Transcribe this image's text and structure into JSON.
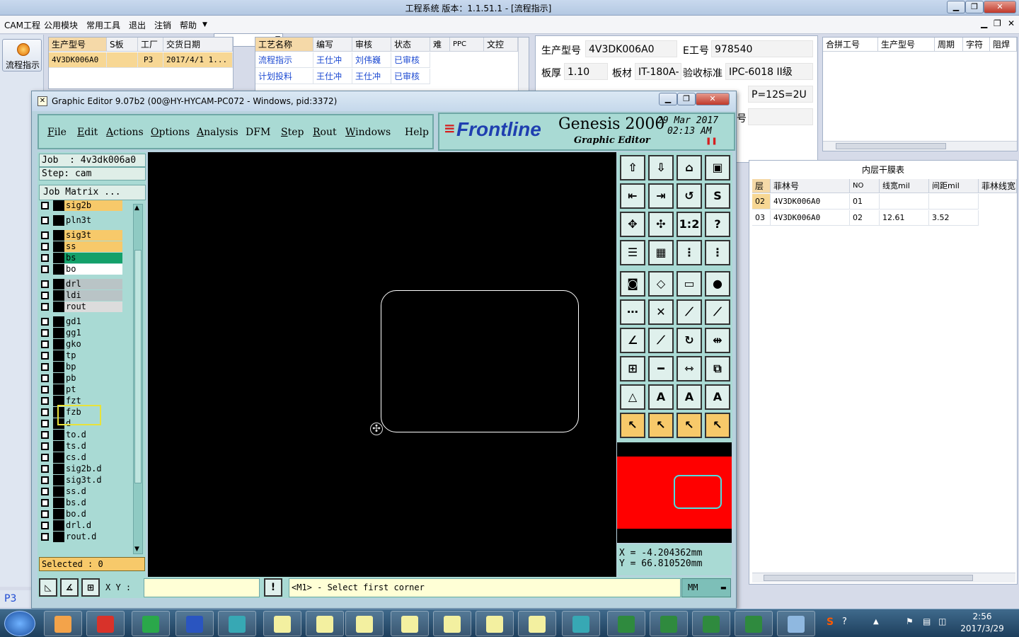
{
  "app": {
    "title": "工程系统    版本：1.1.51.1 - [流程指示]",
    "menu": [
      "CAM工程",
      "公用模块",
      "常用工具",
      "退出",
      "注销",
      "帮助"
    ],
    "flow_button": "流程指示",
    "left_status": "P3"
  },
  "job_grid": {
    "headers": [
      "生产型号",
      "S板",
      "工厂",
      "交货日期"
    ],
    "row": [
      "4V3DK006A0",
      "",
      "P3",
      "2017/4/1 1..."
    ]
  },
  "process_grid": {
    "headers": [
      "工艺名称",
      "编写",
      "审核",
      "状态",
      "难",
      "PPC",
      "文控"
    ],
    "rows": [
      [
        "流程指示",
        "王仕冲",
        "刘伟巍",
        "已审核",
        "",
        "",
        ""
      ],
      [
        "计划投料",
        "王仕冲",
        "王仕冲",
        "已审核",
        "",
        "",
        ""
      ]
    ]
  },
  "info": {
    "model_label": "生产型号",
    "model_value": "4V3DK006A0",
    "eno_label": "E工号",
    "eno_value": "978540",
    "thick_label": "板厚",
    "thick_value": "1.10",
    "material_label": "板材",
    "material_value": "IT-180A-",
    "accept_label": "验收标准",
    "accept_value": "IPC-6018 II级",
    "extra_value": "P=12S=2U",
    "extra_label": "号"
  },
  "panel_grid": {
    "headers": [
      "合拼工号",
      "生产型号",
      "周期",
      "字符",
      "阻焊"
    ]
  },
  "inner_table": {
    "title": "内层干膜表",
    "headers": [
      "层",
      "菲林号",
      "NO",
      "线宽mil",
      "间距mil",
      "菲林线宽"
    ],
    "rows": [
      [
        "02",
        "4V3DK006A0",
        "01",
        "",
        "",
        ""
      ],
      [
        "03",
        "4V3DK006A0",
        "02",
        "12.61",
        "3.52",
        ""
      ]
    ]
  },
  "genesis": {
    "title": "Graphic Editor 9.07b2 (00@HY-HYCAM-PC072 - Windows, pid:3372)",
    "menu": [
      "File",
      "Edit",
      "Actions",
      "Options",
      "Analysis",
      "DFM",
      "Step",
      "Rout",
      "Windows",
      "Help"
    ],
    "logo": "Frontline",
    "product": "Genesis 2000",
    "subtitle": "Graphic Editor",
    "date": "29 Mar 2017",
    "time": "02:13 AM",
    "job": "Job  : 4v3dk006a0",
    "step": "Step: cam",
    "job_matrix": "Job Matrix ...",
    "layers": [
      {
        "name": "sig2b",
        "color": "#f7c96a"
      },
      {
        "name": "pln3t",
        "color": "#a9dad4"
      },
      {
        "name": "sig3t",
        "color": "#f7c96a"
      },
      {
        "name": "ss",
        "color": "#f7c96a"
      },
      {
        "name": "bs",
        "color": "#14a06a"
      },
      {
        "name": "bo",
        "color": "#ffffff"
      },
      {
        "name": "drl",
        "color": "#b9c4c6"
      },
      {
        "name": "ldi",
        "color": "#b9c4c6"
      },
      {
        "name": "rout",
        "color": "#dcdcdc"
      },
      {
        "name": "gd1",
        "color": "#a9dad4"
      },
      {
        "name": "gg1",
        "color": "#a9dad4"
      },
      {
        "name": "gko",
        "color": "#a9dad4"
      },
      {
        "name": "tp",
        "color": "#a9dad4"
      },
      {
        "name": "bp",
        "color": "#a9dad4"
      },
      {
        "name": "pb",
        "color": "#a9dad4"
      },
      {
        "name": "pt",
        "color": "#a9dad4"
      },
      {
        "name": "fzt",
        "color": "#a9dad4"
      },
      {
        "name": "fzb",
        "color": "#a9dad4"
      },
      {
        "name": "d",
        "color": "#a9dad4"
      },
      {
        "name": "to.d",
        "color": "#a9dad4"
      },
      {
        "name": "ts.d",
        "color": "#a9dad4"
      },
      {
        "name": "cs.d",
        "color": "#a9dad4"
      },
      {
        "name": "sig2b.d",
        "color": "#a9dad4"
      },
      {
        "name": "sig3t.d",
        "color": "#a9dad4"
      },
      {
        "name": "ss.d",
        "color": "#a9dad4"
      },
      {
        "name": "bs.d",
        "color": "#a9dad4"
      },
      {
        "name": "bo.d",
        "color": "#a9dad4"
      },
      {
        "name": "drl.d",
        "color": "#a9dad4"
      },
      {
        "name": "rout.d",
        "color": "#a9dad4"
      }
    ],
    "selected": "Selected : 0",
    "xy_label": "X Y :",
    "prompt": "<M1> - Select first corner",
    "units": "MM",
    "coord_x": "X = -4.204362mm",
    "coord_y": "Y = 66.810520mm"
  },
  "taskbar": {
    "time": "2:56",
    "date": "2017/3/29"
  }
}
